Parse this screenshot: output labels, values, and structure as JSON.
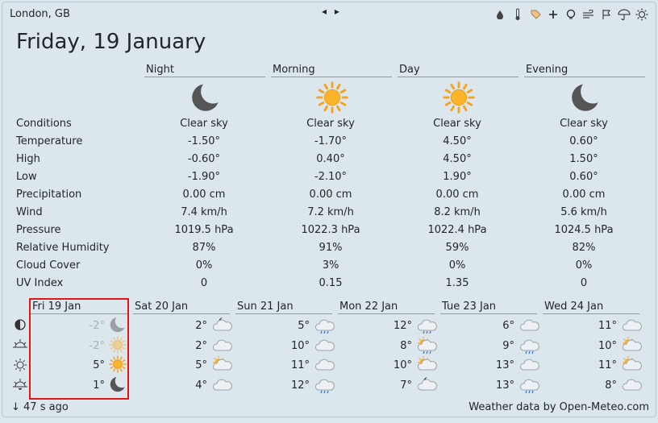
{
  "header": {
    "location": "London, GB",
    "nav_prev": "◂",
    "nav_next": "▸"
  },
  "toolbar_icons": [
    "drop-icon",
    "thermometer-icon",
    "tag-icon",
    "plus-icon",
    "bulb-icon",
    "wind-icon",
    "flag-icon",
    "umbrella-icon",
    "sun-icon"
  ],
  "title": "Friday, 19 January",
  "periods": [
    {
      "name": "Night",
      "icon": "moon",
      "conditions": "Clear sky",
      "temperature": "-1.50°",
      "high": "-0.60°",
      "low": "-1.90°",
      "precipitation": "0.00 cm",
      "wind": "7.4 km/h",
      "pressure": "1019.5 hPa",
      "humidity": "87%",
      "cloud_cover": "0%",
      "uv_index": "0"
    },
    {
      "name": "Morning",
      "icon": "sun",
      "conditions": "Clear sky",
      "temperature": "-1.70°",
      "high": "0.40°",
      "low": "-2.10°",
      "precipitation": "0.00 cm",
      "wind": "7.2 km/h",
      "pressure": "1022.3 hPa",
      "humidity": "91%",
      "cloud_cover": "3%",
      "uv_index": "0.15"
    },
    {
      "name": "Day",
      "icon": "sun",
      "conditions": "Clear sky",
      "temperature": "4.50°",
      "high": "4.50°",
      "low": "1.90°",
      "precipitation": "0.00 cm",
      "wind": "8.2 km/h",
      "pressure": "1022.4 hPa",
      "humidity": "59%",
      "cloud_cover": "0%",
      "uv_index": "1.35"
    },
    {
      "name": "Evening",
      "icon": "moon",
      "conditions": "Clear sky",
      "temperature": "0.60°",
      "high": "1.50°",
      "low": "0.60°",
      "precipitation": "0.00 cm",
      "wind": "5.6 km/h",
      "pressure": "1024.5 hPa",
      "humidity": "82%",
      "cloud_cover": "0%",
      "uv_index": "0"
    }
  ],
  "row_labels": {
    "conditions": "Conditions",
    "temperature": "Temperature",
    "high": "High",
    "low": "Low",
    "precipitation": "Precipitation",
    "wind": "Wind",
    "pressure": "Pressure",
    "humidity": "Relative Humidity",
    "cloud_cover": "Cloud Cover",
    "uv_index": "UV Index"
  },
  "forecast": [
    {
      "day": "Fri 19 Jan",
      "temps": [
        "-2°",
        "-2°",
        "5°",
        "1°"
      ],
      "icons": [
        "moon",
        "sun",
        "sun",
        "moon"
      ]
    },
    {
      "day": "Sat 20 Jan",
      "temps": [
        "2°",
        "2°",
        "5°",
        "4°"
      ],
      "icons": [
        "moon-cloud",
        "cloud",
        "sun-cloud",
        "cloud"
      ]
    },
    {
      "day": "Sun 21 Jan",
      "temps": [
        "5°",
        "10°",
        "11°",
        "12°"
      ],
      "icons": [
        "rain-cloud",
        "cloud",
        "cloud",
        "rain-cloud"
      ]
    },
    {
      "day": "Mon 22 Jan",
      "temps": [
        "12°",
        "8°",
        "10°",
        "7°"
      ],
      "icons": [
        "rain-cloud",
        "sun-rain-cloud",
        "sun-cloud",
        "moon-cloud"
      ]
    },
    {
      "day": "Tue 23 Jan",
      "temps": [
        "6°",
        "9°",
        "13°",
        "13°"
      ],
      "icons": [
        "cloud",
        "rain-cloud",
        "cloud",
        "rain-cloud"
      ]
    },
    {
      "day": "Wed 24 Jan",
      "temps": [
        "11°",
        "10°",
        "11°",
        "8°"
      ],
      "icons": [
        "cloud",
        "sun-cloud",
        "sun-cloud",
        "cloud"
      ]
    }
  ],
  "footer": {
    "updated": "47 s ago",
    "source": "Weather data by Open-Meteo.com"
  }
}
